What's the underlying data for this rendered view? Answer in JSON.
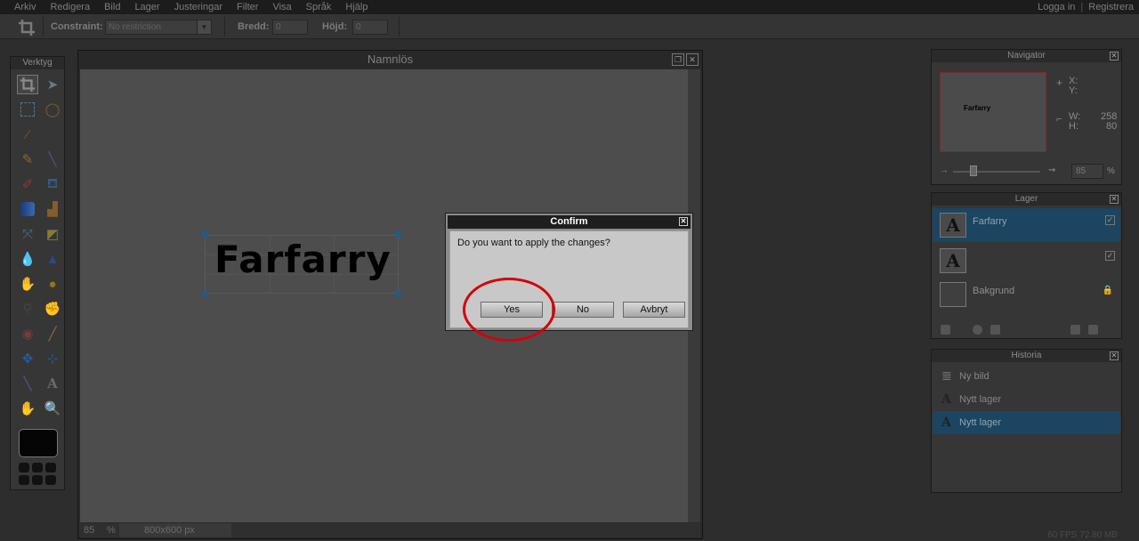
{
  "menu": {
    "items": [
      "Arkiv",
      "Redigera",
      "Bild",
      "Lager",
      "Justeringar",
      "Filter",
      "Visa",
      "Språk",
      "Hjälp"
    ],
    "login": "Logga in",
    "separator": "|",
    "register": "Registrera"
  },
  "options": {
    "constraint_label": "Constraint:",
    "constraint_value": "No restriction",
    "width_label": "Bredd:",
    "width_value": "0",
    "height_label": "Höjd:",
    "height_value": "0"
  },
  "tools": {
    "title": "Verktyg"
  },
  "document": {
    "title": "Namnlös",
    "text_layer": "Farfarry",
    "zoom": "85",
    "zoom_unit": "%",
    "dimensions": "800x600 px"
  },
  "dialog": {
    "title": "Confirm",
    "message": "Do you want to apply the changes?",
    "yes": "Yes",
    "no": "No",
    "cancel": "Avbryt"
  },
  "navigator": {
    "title": "Navigator",
    "thumb_text": "Farfarry",
    "x_label": "X:",
    "y_label": "Y:",
    "w_label": "W:",
    "w_value": "258",
    "h_label": "H:",
    "h_value": "80",
    "zoom_value": "85",
    "zoom_unit": "%"
  },
  "layers": {
    "title": "Lager",
    "items": [
      {
        "name": "Farfarry",
        "thumb": "A"
      },
      {
        "name": "",
        "thumb": "A"
      },
      {
        "name": "Bakgrund",
        "thumb": ""
      }
    ]
  },
  "history": {
    "title": "Historia",
    "items": [
      {
        "label": "Ny bild",
        "icon": "≣"
      },
      {
        "label": "Nytt lager",
        "icon": "A"
      },
      {
        "label": "Nytt lager",
        "icon": "A"
      }
    ]
  },
  "status": {
    "fps": "60 FPS 72.80 MB"
  },
  "colors": {
    "selection": "#1b4560",
    "annotation": "#d4000a"
  }
}
